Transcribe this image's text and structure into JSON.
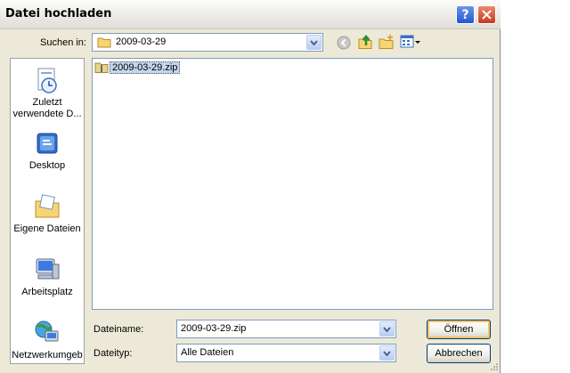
{
  "window": {
    "title": "Datei hochladen"
  },
  "toolbar": {
    "look_in_label": "Suchen in:",
    "look_in_value": "2009-03-29"
  },
  "places": [
    {
      "label": "Zuletzt verwendete D...",
      "icon": "recent-documents-icon"
    },
    {
      "label": "Desktop",
      "icon": "desktop-icon"
    },
    {
      "label": "Eigene Dateien",
      "icon": "my-documents-icon"
    },
    {
      "label": "Arbeitsplatz",
      "icon": "my-computer-icon"
    },
    {
      "label": "Netzwerkumgeb",
      "icon": "network-icon"
    }
  ],
  "files": [
    {
      "name": "2009-03-29.zip",
      "selected": true
    }
  ],
  "fields": {
    "filename_label": "Dateiname:",
    "filename_value": "2009-03-29.zip",
    "filetype_label": "Dateityp:",
    "filetype_value": "Alle Dateien"
  },
  "buttons": {
    "open": "Öffnen",
    "cancel": "Abbrechen"
  },
  "colors": {
    "selection": "#c5d5ee",
    "dialog_bg": "#ece9d8",
    "border": "#7f9db9"
  }
}
